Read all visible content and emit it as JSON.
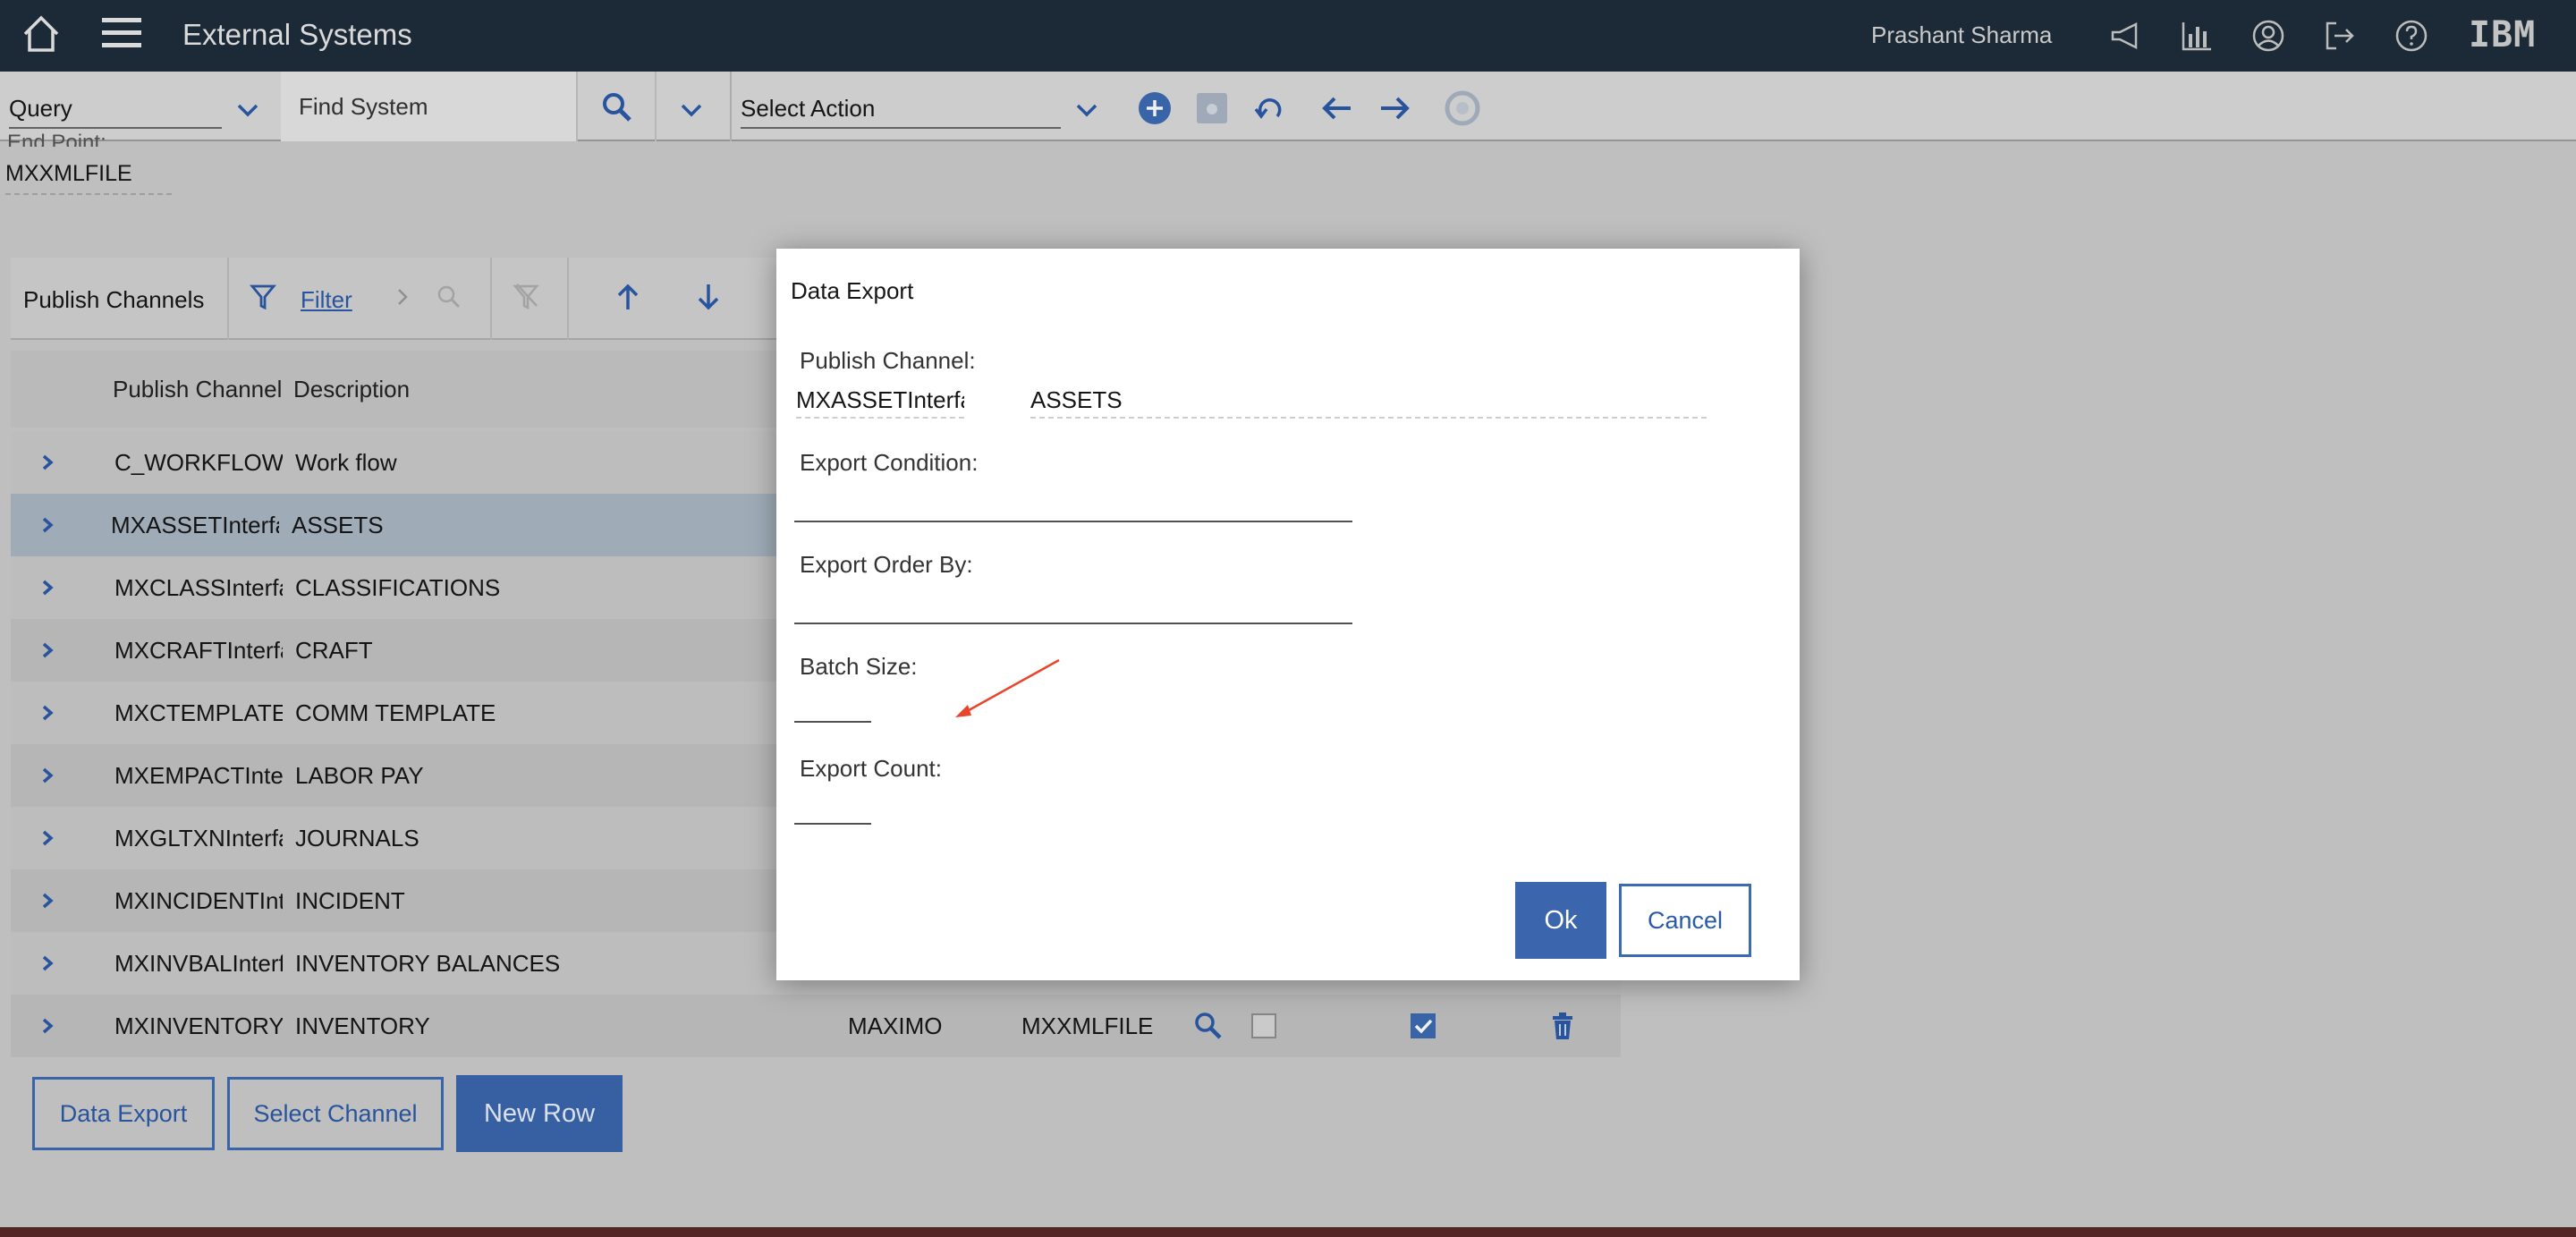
{
  "header": {
    "app_title": "External Systems",
    "user_name": "Prashant Sharma",
    "brand": "IBM",
    "icons": [
      "home-icon",
      "menu-icon",
      "megaphone-icon",
      "bar-chart-icon",
      "user-profile-icon",
      "logout-icon",
      "help-icon"
    ]
  },
  "toolbar": {
    "query_value": "Query",
    "find_placeholder": "Find System",
    "action_value": "Select Action"
  },
  "endpoint": {
    "label": "End Point:",
    "value": "MXXMLFILE"
  },
  "publish_channels": {
    "title": "Publish Channels",
    "filter_label": "Filter",
    "columns": [
      "Publish Channel",
      "Description"
    ],
    "rows": [
      {
        "channel": "C_WORKFLOW",
        "description": "Work flow"
      },
      {
        "channel": "MXASSETInterface",
        "description": "ASSETS",
        "selected": true
      },
      {
        "channel": "MXCLASSInterface",
        "description": "CLASSIFICATIONS"
      },
      {
        "channel": "MXCRAFTInterface",
        "description": "CRAFT"
      },
      {
        "channel": "MXCTEMPLATEInterface",
        "description": "COMM TEMPLATE"
      },
      {
        "channel": "MXEMPACTInterface",
        "description": "LABOR PAY"
      },
      {
        "channel": "MXGLTXNInterface",
        "description": "JOURNALS"
      },
      {
        "channel": "MXINCIDENTInterface",
        "description": "INCIDENT"
      },
      {
        "channel": "MXINVBALInterface",
        "description": "INVENTORY BALANCES"
      },
      {
        "channel": "MXINVENTORY",
        "description": "INVENTORY",
        "system": "MAXIMO",
        "endpoint": "MXXMLFILE"
      }
    ],
    "buttons": {
      "data_export": "Data Export",
      "select_channel": "Select Channel",
      "new_row": "New Row"
    }
  },
  "dialog": {
    "title": "Data Export",
    "publish_channel_label": "Publish Channel:",
    "publish_channel_value": "MXASSETInterface",
    "publish_channel_desc": "ASSETS",
    "export_condition_label": "Export Condition:",
    "export_order_by_label": "Export Order By:",
    "batch_size_label": "Batch Size:",
    "export_count_label": "Export Count:",
    "ok_label": "Ok",
    "cancel_label": "Cancel",
    "annotation_color": "#e8452c"
  },
  "colors": {
    "header_bg": "#1e2d3b",
    "accent": "#3b66ad",
    "selected_row": "#a9b7c4"
  }
}
